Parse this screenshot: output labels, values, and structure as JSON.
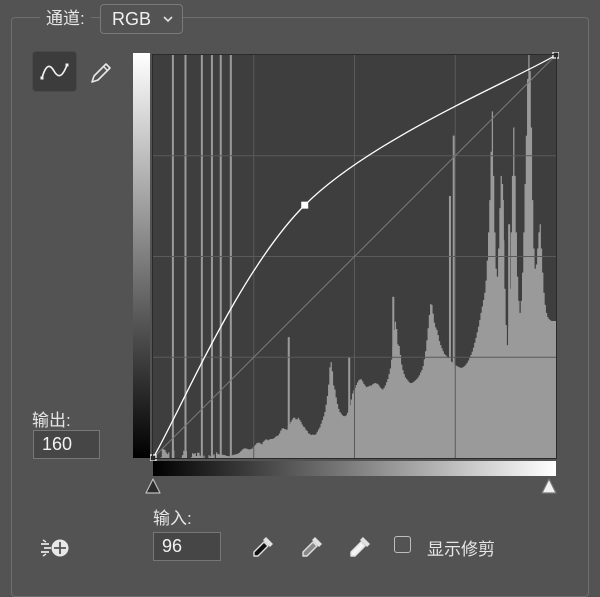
{
  "channel": {
    "label": "通道:",
    "value": "RGB"
  },
  "output": {
    "label": "输出:",
    "value": "160"
  },
  "input": {
    "label": "输入:",
    "value": "96"
  },
  "show_clipping": {
    "label": "显示修剪",
    "checked": false
  },
  "icons": {
    "curve_tool": "curve-edit-icon",
    "pencil_tool": "pencil-icon",
    "auto": "auto-adjust-icon",
    "black_point": "black-eyedropper-icon",
    "gray_point": "gray-eyedropper-icon",
    "white_point": "white-eyedropper-icon",
    "channel_dropdown": "chevron-down-icon"
  },
  "colors": {
    "panel_bg": "#535353",
    "graph_bg": "#3e3e3e",
    "histogram": "#9a9a9a",
    "curve": "#ffffff"
  },
  "curve": {
    "points": [
      [
        0,
        0
      ],
      [
        96,
        160
      ],
      [
        255,
        255
      ]
    ],
    "selected_point": [
      96,
      160
    ]
  },
  "histogram": {
    "levels": [
      0,
      0,
      0,
      0,
      0,
      0,
      2,
      22,
      22,
      20,
      14,
      10,
      14,
      0,
      0,
      19,
      19,
      0,
      0,
      0,
      0,
      0,
      1,
      7,
      18,
      20,
      17,
      0,
      0,
      0,
      2,
      12,
      10,
      12,
      5,
      13,
      13,
      6,
      1,
      1,
      6,
      0,
      0,
      0,
      7,
      4,
      6,
      6,
      9,
      0,
      14,
      10,
      9,
      11,
      8,
      8,
      7,
      7,
      5,
      5,
      4,
      6,
      6,
      8,
      8,
      9,
      10,
      11,
      13,
      16,
      19,
      22,
      24,
      24,
      23,
      22,
      21,
      22,
      23,
      26,
      30,
      33,
      37,
      38,
      38,
      36,
      34,
      40,
      43,
      46,
      46,
      44,
      46,
      47,
      47,
      48,
      50,
      53,
      55,
      56,
      61,
      68,
      73,
      74,
      72,
      71,
      70,
      79,
      85,
      90,
      95,
      100,
      100,
      96,
      96,
      100,
      95,
      90,
      83,
      78,
      76,
      70,
      67,
      61,
      60,
      57,
      58,
      58,
      57,
      60,
      65,
      71,
      76,
      85,
      94,
      103,
      114,
      132,
      154,
      182,
      225,
      238,
      215,
      180,
      170,
      150,
      134,
      122,
      114,
      110,
      106,
      104,
      104,
      106,
      112,
      120,
      131,
      145,
      160,
      168,
      174,
      181,
      188,
      193,
      195,
      195,
      190,
      184,
      180,
      176,
      177,
      178,
      180,
      180,
      183,
      185,
      186,
      185,
      184,
      180,
      175,
      172,
      170,
      174,
      180,
      188,
      196,
      208,
      222,
      244,
      276,
      318,
      338,
      320,
      282,
      278,
      256,
      232,
      218,
      208,
      200,
      196,
      192,
      188,
      186,
      186,
      188,
      190,
      193,
      196,
      200,
      205,
      212,
      218,
      228,
      245,
      265,
      292,
      322,
      355,
      382,
      380,
      358,
      336,
      324,
      318,
      305,
      290,
      280,
      272,
      265,
      258,
      255,
      252,
      248,
      245,
      240,
      238,
      235,
      232,
      230,
      228,
      226,
      225,
      224,
      224,
      226,
      228,
      232,
      236,
      242,
      248,
      256,
      264,
      274,
      286,
      298,
      312,
      326,
      342,
      360,
      376,
      392,
      410,
      440,
      490,
      560,
      640,
      760,
      860,
      700,
      560,
      470,
      450,
      520,
      620,
      700,
      680,
      540,
      420,
      330,
      280,
      320,
      420,
      560,
      700,
      820,
      700,
      560,
      450,
      390,
      360,
      390,
      460,
      560,
      680,
      800,
      940,
      1000,
      960,
      820,
      640,
      520,
      470,
      480,
      520,
      560,
      580,
      520,
      460,
      410,
      380,
      360,
      350,
      345,
      342,
      340,
      340,
      340,
      340
    ],
    "spikes": [
      [
        15,
        1000
      ],
      [
        25,
        1000
      ],
      [
        38,
        1000
      ],
      [
        46,
        1000
      ],
      [
        53,
        1000
      ],
      [
        61,
        1000
      ],
      [
        107,
        300
      ],
      [
        155,
        250
      ],
      [
        190,
        400
      ],
      [
        235,
        650
      ],
      [
        238,
        800
      ],
      [
        277,
        640
      ],
      [
        282,
        580
      ],
      [
        301,
        450
      ],
      [
        367,
        520
      ],
      [
        379,
        530
      ],
      [
        412,
        630
      ],
      [
        427,
        600
      ],
      [
        438,
        470
      ],
      [
        460,
        700
      ],
      [
        464,
        750
      ],
      [
        487,
        550
      ],
      [
        490,
        500
      ],
      [
        505,
        620
      ],
      [
        511,
        1000
      ],
      [
        513,
        560
      ],
      [
        518,
        390
      ],
      [
        523,
        420
      ],
      [
        531,
        320
      ],
      [
        536,
        280
      ],
      [
        545,
        300
      ]
    ]
  }
}
